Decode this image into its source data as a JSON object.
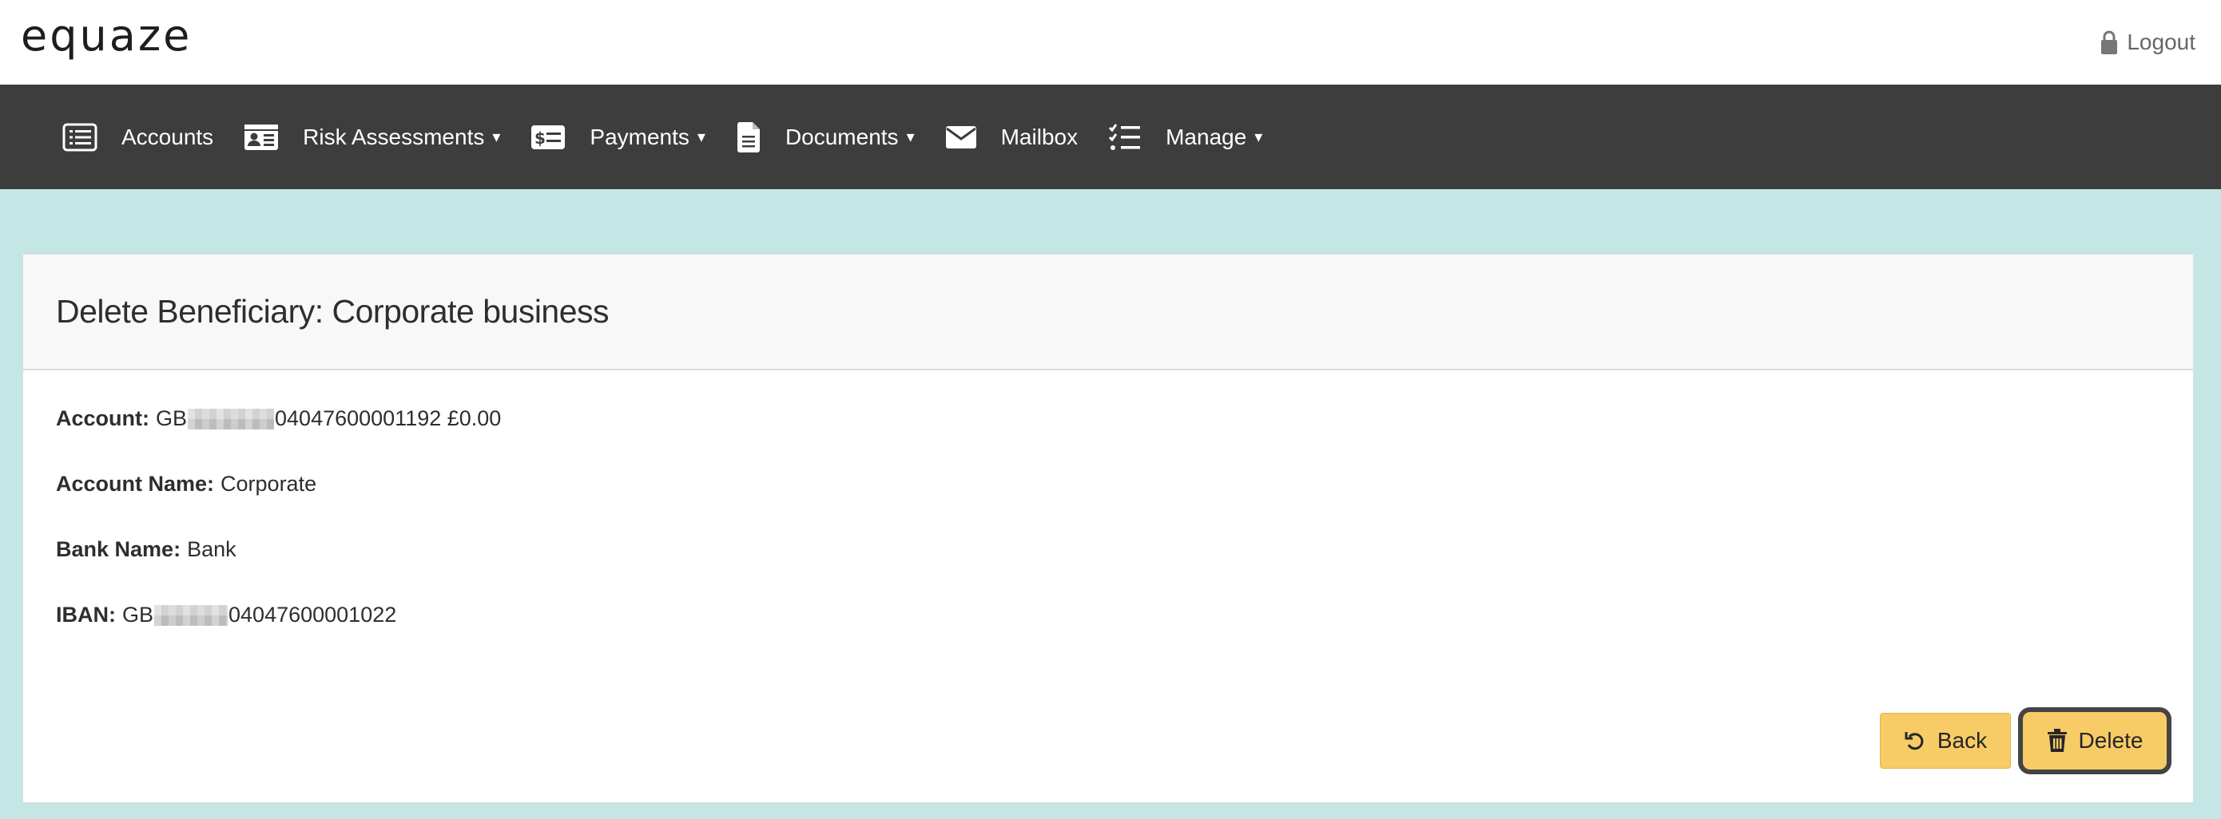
{
  "header": {
    "logo": "equaze",
    "logout_label": "Logout"
  },
  "nav": {
    "items": [
      {
        "label": "Accounts",
        "icon": "list-icon",
        "dropdown": false
      },
      {
        "label": "Risk Assessments",
        "icon": "id-card-icon",
        "dropdown": true
      },
      {
        "label": "Payments",
        "icon": "money-bill-icon",
        "dropdown": true
      },
      {
        "label": "Documents",
        "icon": "document-icon",
        "dropdown": true
      },
      {
        "label": "Mailbox",
        "icon": "envelope-icon",
        "dropdown": false
      },
      {
        "label": "Manage",
        "icon": "checklist-icon",
        "dropdown": true
      }
    ],
    "caret": "▾"
  },
  "page": {
    "title": "Delete Beneficiary: Corporate business",
    "fields": {
      "account": {
        "label": "Account:",
        "prefix": "GB",
        "suffix": "04047600001192 £0.00"
      },
      "account_name": {
        "label": "Account Name:",
        "value": "Corporate"
      },
      "bank_name": {
        "label": "Bank Name:",
        "value": "Bank"
      },
      "iban": {
        "label": "IBAN:",
        "prefix": "GB",
        "suffix": "04047600001022"
      }
    },
    "buttons": {
      "back": "Back",
      "delete": "Delete"
    }
  },
  "colors": {
    "background": "#c4e6e5",
    "navbar": "#3d3d3d",
    "button": "#f7cc67"
  }
}
